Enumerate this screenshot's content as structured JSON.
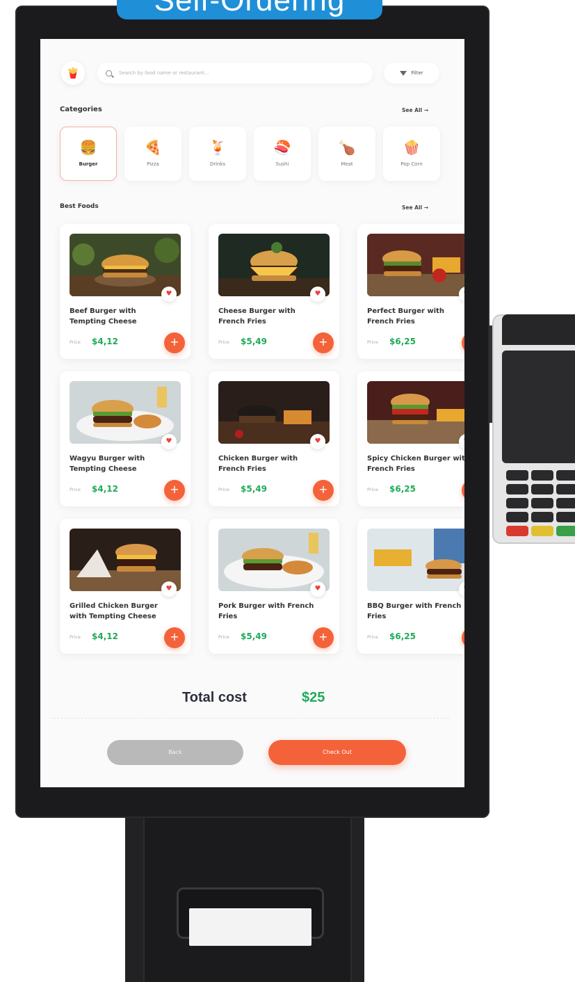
{
  "kiosk_title": "Self-Ordering",
  "header": {
    "search_placeholder": "Search by food name or restaurant...",
    "filter_label": "Filter"
  },
  "categories": {
    "title": "Categories",
    "see_all": "See All →",
    "items": [
      {
        "label": "Burger",
        "icon": "burger-icon",
        "glyph": "🍔"
      },
      {
        "label": "Pizza",
        "icon": "pizza-icon",
        "glyph": "🍕"
      },
      {
        "label": "Drinks",
        "icon": "drink-icon",
        "glyph": "🍹"
      },
      {
        "label": "Sushi",
        "icon": "sushi-icon",
        "glyph": "🍣"
      },
      {
        "label": "Meat",
        "icon": "meat-icon",
        "glyph": "🍗"
      },
      {
        "label": "Pop Corn",
        "icon": "popcorn-icon",
        "glyph": "🍿"
      }
    ]
  },
  "best_foods": {
    "title": "Best Foods",
    "see_all": "See All →",
    "price_label": "Price",
    "items": [
      {
        "name": "Beef Burger with Tempting Cheese",
        "price": "$4,12"
      },
      {
        "name": "Cheese Burger with French Fries",
        "price": "$5,49"
      },
      {
        "name": "Perfect Burger with French Fries",
        "price": "$6,25"
      },
      {
        "name": "Wagyu Burger with Tempting Cheese",
        "price": "$4,12"
      },
      {
        "name": "Chicken Burger with French Fries",
        "price": "$5,49"
      },
      {
        "name": "Spicy Chicken Burger with French Fries",
        "price": "$6,25"
      },
      {
        "name": "Grilled Chicken Burger with Tempting Cheese",
        "price": "$4,12"
      },
      {
        "name": "Pork Burger with French Fries",
        "price": "$5,49"
      },
      {
        "name": "BBQ Burger with French Fries",
        "price": "$6,25"
      }
    ]
  },
  "footer": {
    "total_label": "Total cost",
    "total_value": "$25",
    "back_label": "Back",
    "checkout_label": "Check Out"
  },
  "colors": {
    "accent": "#f4623a",
    "price": "#1faa59",
    "banner": "#1f8fd8",
    "bezel": "#1b1b1d"
  }
}
